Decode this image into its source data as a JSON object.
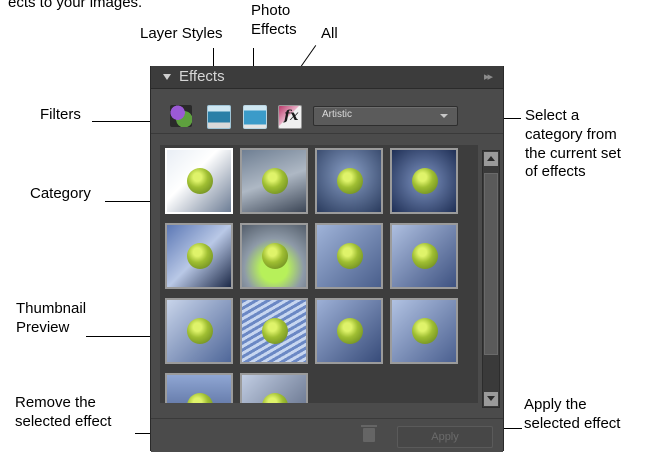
{
  "intro_text": "ects to your images.",
  "callouts": {
    "photo_effects": "Photo\nEffects",
    "layer_styles": "Layer Styles",
    "all": "All",
    "filters": "Filters",
    "category": "Category",
    "thumbnail_preview": "Thumbnail\nPreview",
    "remove_effect": "Remove the\nselected effect",
    "select_category": "Select a\ncategory from\nthe current set\nof effects",
    "apply_effect": "Apply the\nselected effect"
  },
  "panel": {
    "title": "Effects",
    "menu_icon": "double-chevron-right-icon",
    "toolbar_icons": [
      "filters-icon",
      "layer-styles-icon",
      "photo-effects-icon",
      "all-icon"
    ],
    "all_icon_glyph": "fx",
    "category_select": {
      "value": "Artistic"
    },
    "thumbnail_count": 14,
    "selected_thumbnail": 1,
    "apply_label": "Apply",
    "colors": {
      "panel_bg": "#4b4b4b",
      "header_bg": "#3c3c3c",
      "grid_bg": "#3d3d3d",
      "thumb_border": "#9b9b9b"
    }
  }
}
